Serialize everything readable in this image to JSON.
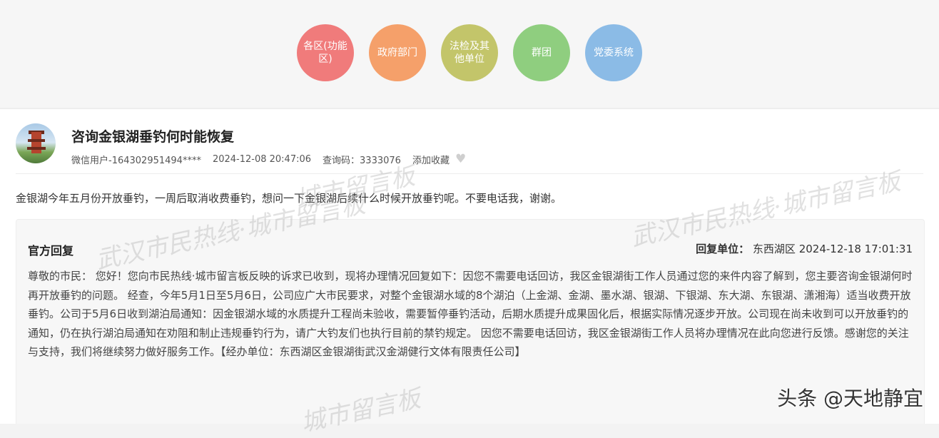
{
  "categories": [
    {
      "label": "各区(功能区)",
      "color": "#f07b7b"
    },
    {
      "label": "政府部门",
      "color": "#f5a06a"
    },
    {
      "label": "法检及其他单位",
      "color": "#c3c56a"
    },
    {
      "label": "群团",
      "color": "#8fce7f"
    },
    {
      "label": "党委系统",
      "color": "#8bbbe6"
    }
  ],
  "post": {
    "title": "咨询金银湖垂钓何时能恢复",
    "user": "微信用户-164302951494****",
    "datetime": "2024-12-08 20:47:06",
    "query_code": "查询码：3333076",
    "favorite_label": "添加收藏",
    "question": "金银湖今年五月份开放垂钓，一周后取消收费垂钓，想问一下金银湖后续什么时候开放垂钓呢。不要电话我，谢谢。"
  },
  "reply": {
    "label": "官方回复",
    "unit_label": "回复单位：",
    "unit_value": "东西湖区 2024-12-18 17:01:31",
    "body": "尊敬的市民： 您好！您向市民热线·城市留言板反映的诉求已收到，现将办理情况回复如下：因您不需要电话回访，我区金银湖街工作人员通过您的来件内容了解到，您主要咨询金银湖何时再开放垂钓的问题。 经查，今年5月1日至5月6日，公司应广大市民要求，对整个金银湖水域的8个湖泊（上金湖、金湖、墨水湖、银湖、下银湖、东大湖、东银湖、潇湘海）适当收费开放垂钓。公司于5月6日收到湖泊局通知：因金银湖水域的水质提升工程尚未验收，需要暂停垂钓活动，后期水质提升成果固化后，根据实际情况逐步开放。公司现在尚未收到可以开放垂钓的通知，仍在执行湖泊局通知在劝阻和制止违规垂钓行为，请广大钓友们也执行目前的禁钓规定。 因您不需要电话回访，我区金银湖街工作人员将办理情况在此向您进行反馈。感谢您的关注与支持，我们将继续努力做好服务工作。【经办单位：东西湖区金银湖街武汉金湖健行文体有限责任公司】"
  },
  "watermarks": {
    "site": "城市留言板",
    "hotline": "武汉市民热线·城市留言板",
    "brand": "头条 @天地静宜"
  }
}
